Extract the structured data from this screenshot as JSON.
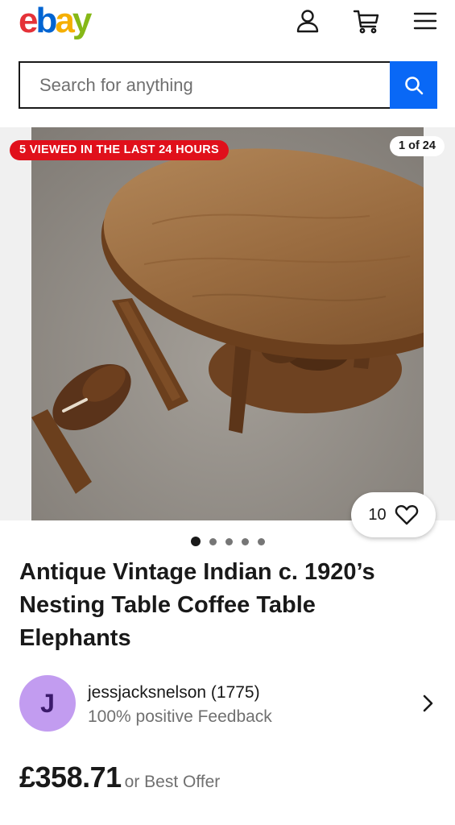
{
  "header": {
    "logo": {
      "letters": [
        "e",
        "b",
        "a",
        "y"
      ],
      "colors": [
        "#e53238",
        "#0064d2",
        "#f5af02",
        "#86b817"
      ]
    },
    "icons": {
      "account": "account-icon",
      "cart": "cart-icon",
      "menu": "hamburger-menu-icon"
    }
  },
  "search": {
    "placeholder": "Search for anything",
    "value": "",
    "button_icon": "search-icon",
    "button_color": "#0968f6"
  },
  "gallery": {
    "viewed_badge": "5 VIEWED IN THE LAST 24 HOURS",
    "counter": "1 of 24",
    "watch_count": "10",
    "watch_icon": "heart-icon",
    "dots_total": 5,
    "dots_active": 0
  },
  "listing": {
    "title": "Antique Vintage Indian c. 1920’s Nesting Table Coffee Table Elephants",
    "price": "£358.71",
    "offer_text": "or Best Offer"
  },
  "seller": {
    "avatar_letter": "J",
    "avatar_color": "#c29cf0",
    "name": "jessjacksnelson (1775)",
    "feedback": "100% positive Feedback",
    "chevron_icon": "chevron-right-icon"
  }
}
